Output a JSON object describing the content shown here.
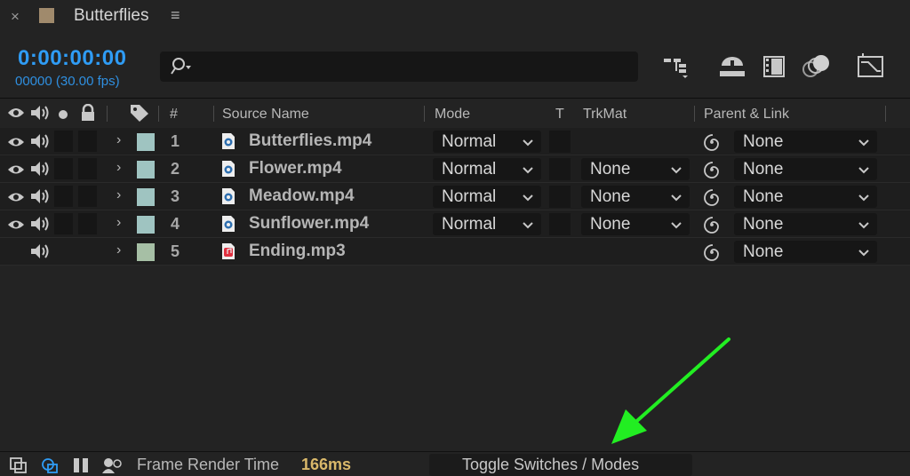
{
  "tab": {
    "close": "×",
    "title": "Butterflies",
    "menu": "≡",
    "swatch_color": "#a08a6c"
  },
  "header": {
    "timecode": "0:00:00:00",
    "frames": "00000 (30.00 fps)",
    "search": {
      "value": "",
      "placeholder": ""
    },
    "icons": [
      "composition-flowchart-icon",
      "draft-3d-icon",
      "frame-blending-icon",
      "motion-blur-icon",
      "graph-editor-icon"
    ]
  },
  "columns": {
    "source_name": "Source Name",
    "mode": "Mode",
    "t": "T",
    "trkmat": "TrkMat",
    "parent": "Parent & Link",
    "number": "#"
  },
  "layers": [
    {
      "num": "1",
      "name": "Butterflies.mp4",
      "type": "video",
      "video": true,
      "mode": "Normal",
      "trkmat": "",
      "parent": "None",
      "color": "#9fc4c1"
    },
    {
      "num": "2",
      "name": "Flower.mp4",
      "type": "video",
      "video": true,
      "mode": "Normal",
      "trkmat": "None",
      "parent": "None",
      "color": "#9fc4c1"
    },
    {
      "num": "3",
      "name": "Meadow.mp4",
      "type": "video",
      "video": true,
      "mode": "Normal",
      "trkmat": "None",
      "parent": "None",
      "color": "#9fc4c1"
    },
    {
      "num": "4",
      "name": "Sunflower.mp4",
      "type": "video",
      "video": true,
      "mode": "Normal",
      "trkmat": "None",
      "parent": "None",
      "color": "#9fc4c1"
    },
    {
      "num": "5",
      "name": "Ending.mp3",
      "type": "audio",
      "video": false,
      "mode": "",
      "trkmat": "",
      "parent": "None",
      "color": "#a6bfa5"
    }
  ],
  "footer": {
    "frame_render_label": "Frame Render Time",
    "frame_render_value": "166ms",
    "toggle_label": "Toggle Switches / Modes"
  },
  "annotation": {
    "arrow_color": "#22ee22"
  }
}
